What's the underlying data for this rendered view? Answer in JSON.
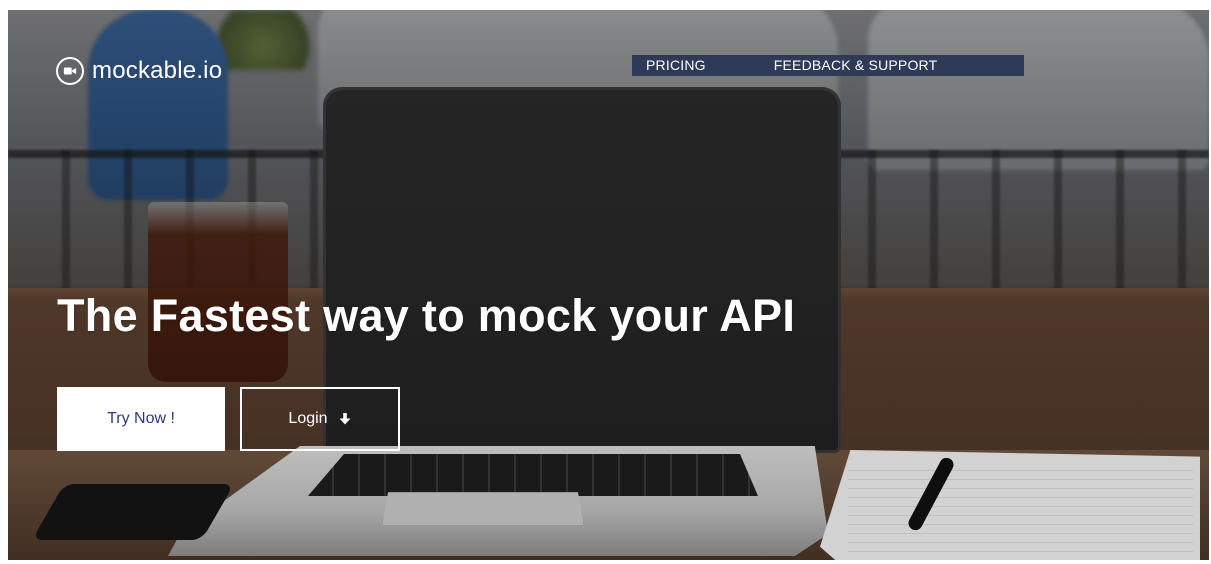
{
  "header": {
    "logo_text": "mockable.io",
    "logo_icon": "video-camera-icon"
  },
  "nav": {
    "items": [
      {
        "label": "PRICING"
      },
      {
        "label": "FEEDBACK & SUPPORT"
      }
    ]
  },
  "hero": {
    "headline": "The Fastest way to mock your API",
    "primary_button": "Try Now !",
    "secondary_button": "Login",
    "secondary_button_icon": "arrow-down-icon"
  },
  "colors": {
    "nav_bg": "#2f3a58",
    "primary_button_text": "#2f3a78",
    "text_light": "#ffffff"
  }
}
